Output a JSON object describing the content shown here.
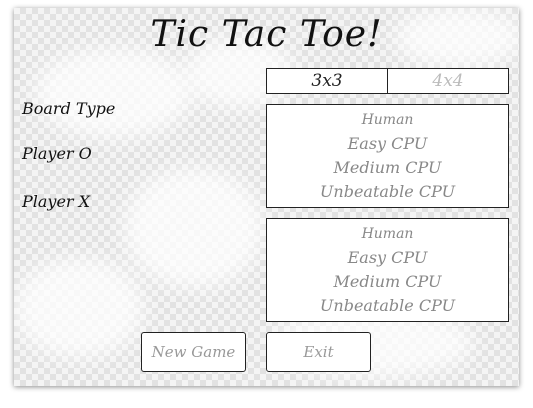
{
  "title": "Tic Tac Toe!",
  "labels": {
    "board_type": "Board Type",
    "player_o": "Player O",
    "player_x": "Player X"
  },
  "board_type": {
    "options": [
      "3x3",
      "4x4"
    ],
    "selected": "3x3"
  },
  "player_o_options": [
    "Human",
    "Easy CPU",
    "Medium CPU",
    "Unbeatable CPU"
  ],
  "player_x_options": [
    "Human",
    "Easy CPU",
    "Medium CPU",
    "Unbeatable CPU"
  ],
  "buttons": {
    "new_game": "New Game",
    "exit": "Exit"
  }
}
